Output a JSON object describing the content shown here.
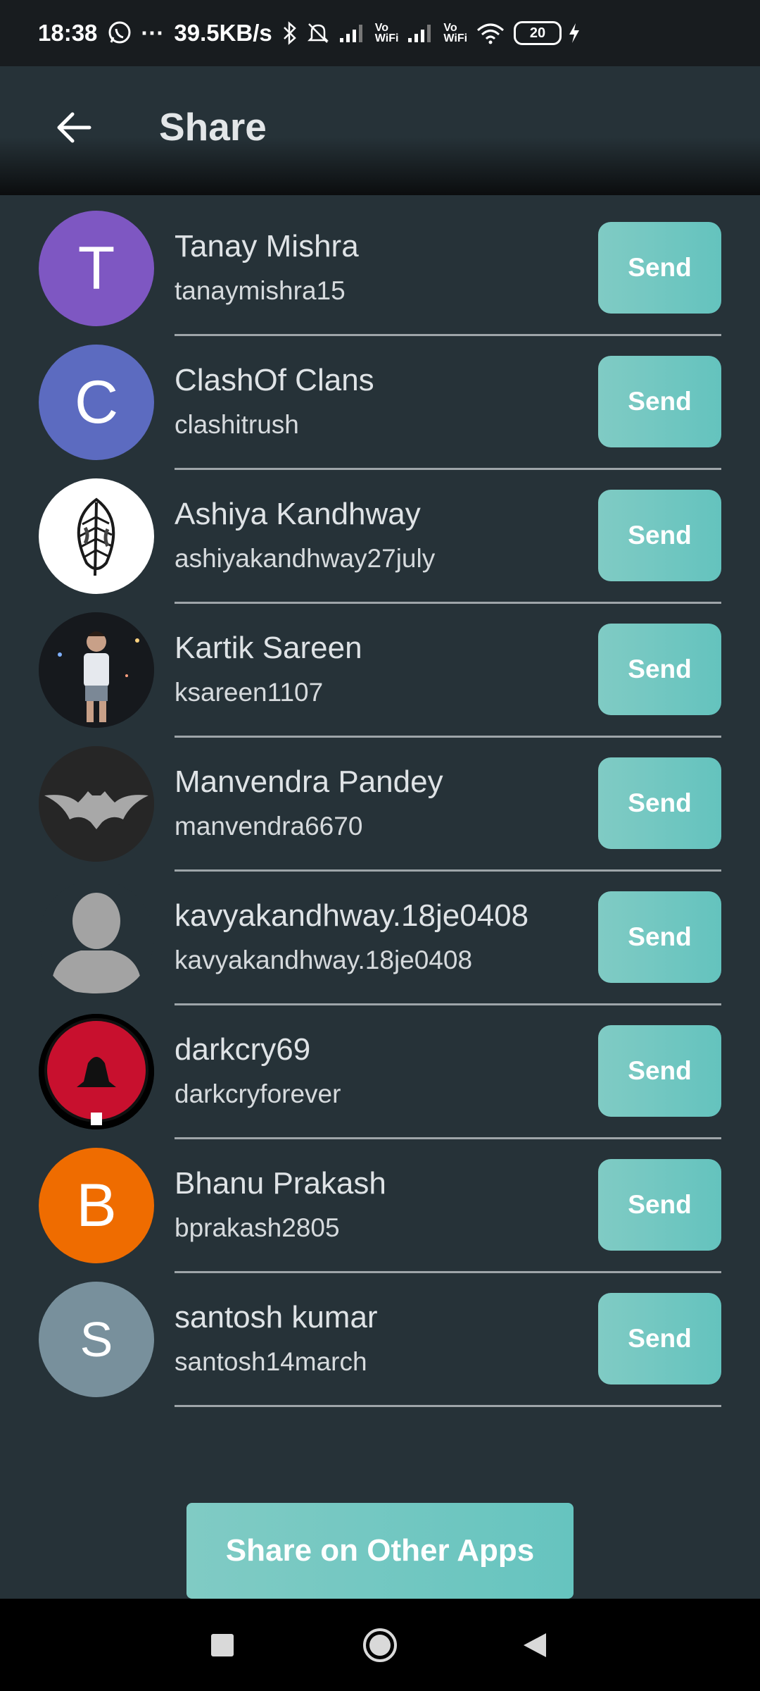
{
  "status_bar": {
    "time": "18:38",
    "dots": "···",
    "speed": "39.5KB/s",
    "vowifi1_top": "Vo",
    "vowifi1_bottom": "WiFi",
    "vowifi2_top": "Vo",
    "vowifi2_bottom": "WiFi",
    "battery": "20",
    "icons": [
      "whatsapp-icon",
      "bluetooth-icon",
      "silent-bell-icon",
      "signal-icon",
      "wifi-icon",
      "charging-icon"
    ]
  },
  "header": {
    "title": "Share",
    "back_icon": "arrow-left-icon"
  },
  "contacts": [
    {
      "name": "Tanay Mishra",
      "username": "tanaymishra15",
      "initial": "T",
      "avatar_color": "#7e57c2",
      "send_label": "Send"
    },
    {
      "name": "ClashOf Clans",
      "username": "clashitrush",
      "initial": "C",
      "avatar_color": "#5c6bc0",
      "send_label": "Send"
    },
    {
      "name": "Ashiya Kandhway",
      "username": "ashiyakandhway27july",
      "initial": "",
      "avatar_color": "#ffffff",
      "send_label": "Send"
    },
    {
      "name": "Kartik Sareen",
      "username": "ksareen1107",
      "initial": "",
      "avatar_color": "#1b1f24",
      "send_label": "Send"
    },
    {
      "name": "Manvendra Pandey",
      "username": "manvendra6670",
      "initial": "",
      "avatar_color": "#2b2b2b",
      "send_label": "Send"
    },
    {
      "name": "kavyakandhway.18je0408",
      "username": "kavyakandhway.18je0408",
      "initial": "",
      "avatar_color": "#263238",
      "send_label": "Send"
    },
    {
      "name": "darkcry69",
      "username": "darkcryforever",
      "initial": "",
      "avatar_color": "#000000",
      "send_label": "Send"
    },
    {
      "name": "Bhanu Prakash",
      "username": "bprakash2805",
      "initial": "B",
      "avatar_color": "#ef6c00",
      "send_label": "Send"
    },
    {
      "name": "santosh kumar",
      "username": "santosh14march",
      "initial": "S",
      "avatar_color": "#78909c",
      "send_label": "Send"
    }
  ],
  "footer": {
    "share_other_label": "Share on Other Apps"
  },
  "nav_bar": {
    "icons": [
      "recent-apps-square-icon",
      "home-circle-icon",
      "back-triangle-icon"
    ]
  },
  "colors": {
    "background": "#263238",
    "accent": "#80cbc4",
    "status_bar": "#181c1f",
    "divider": "#9ea5a9"
  }
}
